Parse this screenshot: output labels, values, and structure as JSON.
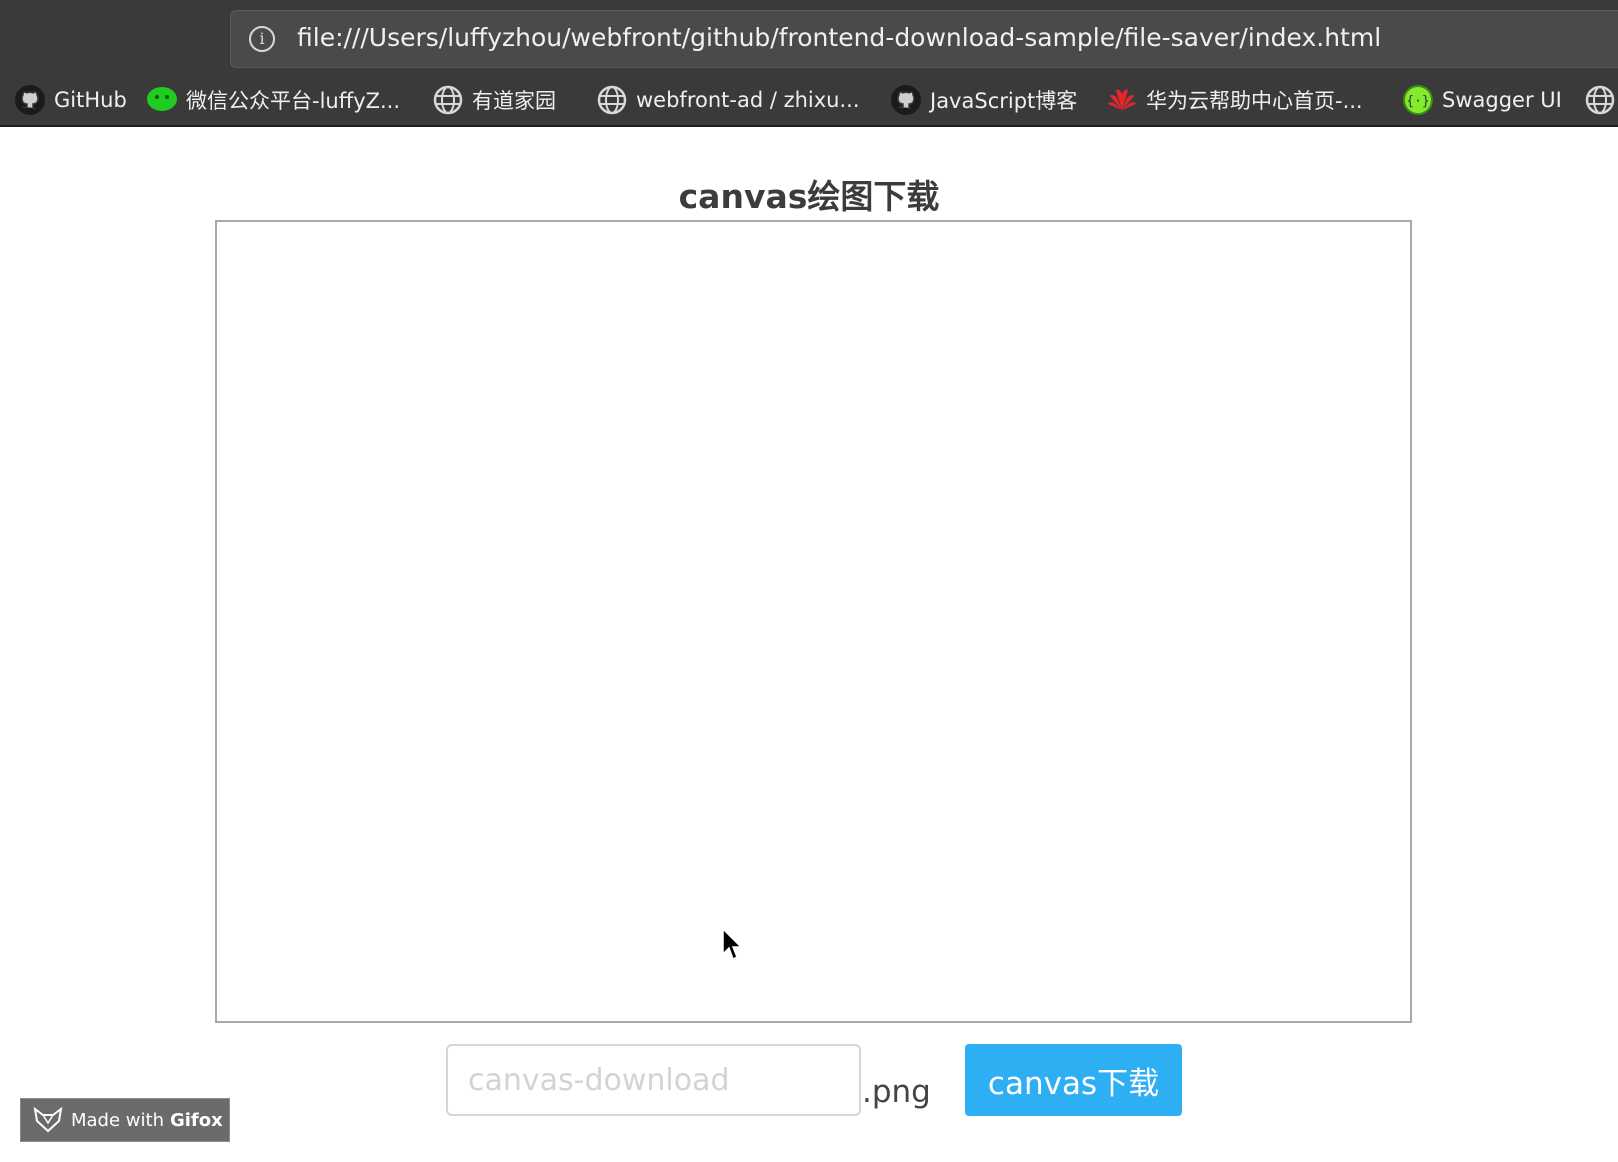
{
  "browser": {
    "url": "file:///Users/luffyzhou/webfront/github/frontend-download-sample/file-saver/index.html",
    "info_icon": "info-icon",
    "bookmarks": [
      {
        "label": "GitHub",
        "icon": "github-icon"
      },
      {
        "label": "微信公众平台-luffyZ...",
        "icon": "wechat-icon"
      },
      {
        "label": "有道家园",
        "icon": "globe-icon"
      },
      {
        "label": "webfront-ad / zhixu...",
        "icon": "globe-icon"
      },
      {
        "label": "JavaScript博客",
        "icon": "github-icon"
      },
      {
        "label": "华为云帮助中心首页-...",
        "icon": "huawei-icon"
      },
      {
        "label": "Swagger UI",
        "icon": "swagger-icon"
      },
      {
        "label": "",
        "icon": "globe-icon"
      }
    ]
  },
  "page": {
    "title": "canvas绘图下载",
    "filename_placeholder": "canvas-download",
    "filename_value": "",
    "extension": ".png",
    "download_label": "canvas下载"
  },
  "overlay": {
    "made_with": "Made with",
    "brand": "Gifox"
  },
  "colors": {
    "chrome_bg": "#3a3a3a",
    "button_bg": "#2eaef3",
    "canvas_border": "#a9a9a9"
  }
}
